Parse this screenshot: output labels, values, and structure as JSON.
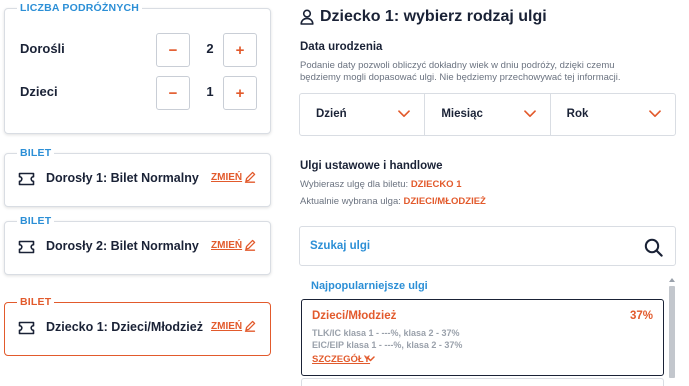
{
  "passengers": {
    "legend": "LICZBA PODRÓŻNYCH",
    "rows": [
      {
        "label": "Dorośli",
        "minus": "−",
        "plus": "+",
        "value": "2"
      },
      {
        "label": "Dzieci",
        "minus": "−",
        "plus": "+",
        "value": "1"
      }
    ]
  },
  "tickets": [
    {
      "legend": "BILET",
      "name": "Dorosły 1: Bilet Normalny",
      "change": "ZMIEŃ",
      "active": false
    },
    {
      "legend": "BILET",
      "name": "Dorosły 2: Bilet Normalny",
      "change": "ZMIEŃ",
      "active": false
    },
    {
      "legend": "BILET",
      "name": "Dziecko 1: Dzieci/Młodzież",
      "change": "ZMIEŃ",
      "active": true
    }
  ],
  "panel": {
    "title": "Dziecko 1: wybierz rodzaj ulgi",
    "birth_date": {
      "label": "Data urodzenia",
      "help_line1": "Podanie daty pozwoli obliczyć dokładny wiek w dniu podróży, dzięki czemu",
      "help_line2": "będziemy mogli dopasować ulgi. Nie będziemy przechowywać tej informacji.",
      "day": "Dzień",
      "month": "Miesiąc",
      "year": "Rok"
    },
    "discounts": {
      "label": "Ulgi ustawowe i handlowe",
      "choosing_prefix": "Wybierasz ulgę dla biletu:",
      "choosing_value": "DZIECKO 1",
      "selected_prefix": "Aktualnie wybrana ulga:",
      "selected_value": "DZIECI/MŁODZIEŻ",
      "search_placeholder": "Szukaj ulgi",
      "popular_label": "Najpopularniejsze ulgi",
      "offer": {
        "name": "Dzieci/Młodzież",
        "percent": "37%",
        "line1": "TLK/IC klasa 1 - ---%, klasa 2 - 37%",
        "line2": "EIC/EIP klasa 1 - ---%, klasa 2 - 37%",
        "details": "SZCZEGÓŁY"
      }
    }
  },
  "colors": {
    "accent_orange": "#e25a2c",
    "accent_blue": "#2c8fd6",
    "text_dark": "#1a2236",
    "border": "#d9dde3"
  },
  "icons": {
    "title": "user-icon",
    "ticket": "ticket-icon",
    "change": "pencil-icon",
    "dropdown": "chevron-down-icon",
    "search": "search-icon"
  }
}
